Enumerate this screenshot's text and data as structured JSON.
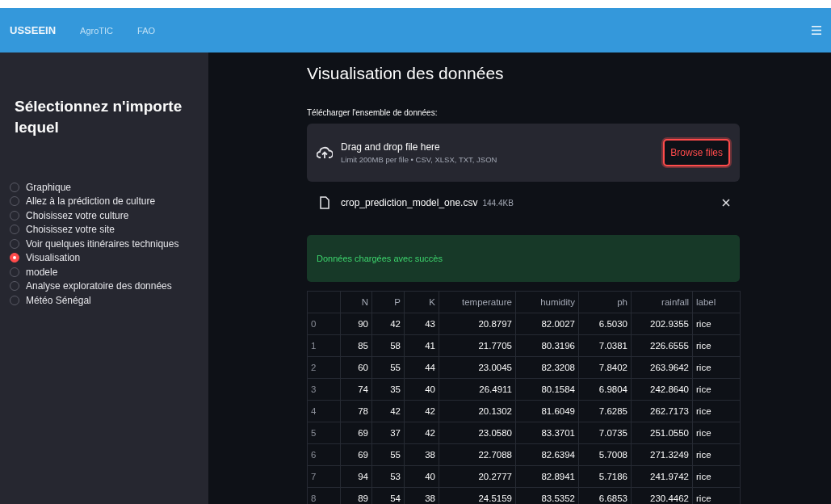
{
  "topbar": {
    "brand": "USSEEIN",
    "links": [
      "AgroTIC",
      "FAO"
    ]
  },
  "sidebar": {
    "title": "Sélectionnez n'importe lequel",
    "options": [
      {
        "label": "Graphique",
        "selected": false
      },
      {
        "label": "Allez à la prédiction de culture",
        "selected": false
      },
      {
        "label": "Choisissez votre culture",
        "selected": false
      },
      {
        "label": "Choisissez votre site",
        "selected": false
      },
      {
        "label": "Voir quelques itinéraires techniques",
        "selected": false
      },
      {
        "label": "Visualisation",
        "selected": true
      },
      {
        "label": "modele",
        "selected": false
      },
      {
        "label": "Analyse exploratoire des données",
        "selected": false
      },
      {
        "label": "Météo Sénégal",
        "selected": false
      }
    ]
  },
  "main": {
    "title": "Visualisation des données",
    "uploader": {
      "label": "Télécharger l'ensemble de données:",
      "drop_text": "Drag and drop file here",
      "limit": "Limit 200MB per file • CSV, XLSX, TXT, JSON",
      "button": "Browse files"
    },
    "file": {
      "name": "crop_prediction_model_one.csv",
      "size": "144.4KB"
    },
    "success": "Données chargées avec succès",
    "table": {
      "columns": [
        "",
        "N",
        "P",
        "K",
        "temperature",
        "humidity",
        "ph",
        "rainfall",
        "label"
      ],
      "rows": [
        [
          "0",
          "90",
          "42",
          "43",
          "20.8797",
          "82.0027",
          "6.5030",
          "202.9355",
          "rice"
        ],
        [
          "1",
          "85",
          "58",
          "41",
          "21.7705",
          "80.3196",
          "7.0381",
          "226.6555",
          "rice"
        ],
        [
          "2",
          "60",
          "55",
          "44",
          "23.0045",
          "82.3208",
          "7.8402",
          "263.9642",
          "rice"
        ],
        [
          "3",
          "74",
          "35",
          "40",
          "26.4911",
          "80.1584",
          "6.9804",
          "242.8640",
          "rice"
        ],
        [
          "4",
          "78",
          "42",
          "42",
          "20.1302",
          "81.6049",
          "7.6285",
          "262.7173",
          "rice"
        ],
        [
          "5",
          "69",
          "37",
          "42",
          "23.0580",
          "83.3701",
          "7.0735",
          "251.0550",
          "rice"
        ],
        [
          "6",
          "69",
          "55",
          "38",
          "22.7088",
          "82.6394",
          "5.7008",
          "271.3249",
          "rice"
        ],
        [
          "7",
          "94",
          "53",
          "40",
          "20.2777",
          "82.8941",
          "5.7186",
          "241.9742",
          "rice"
        ],
        [
          "8",
          "89",
          "54",
          "38",
          "24.5159",
          "83.5352",
          "6.6853",
          "230.4462",
          "rice"
        ]
      ]
    }
  }
}
